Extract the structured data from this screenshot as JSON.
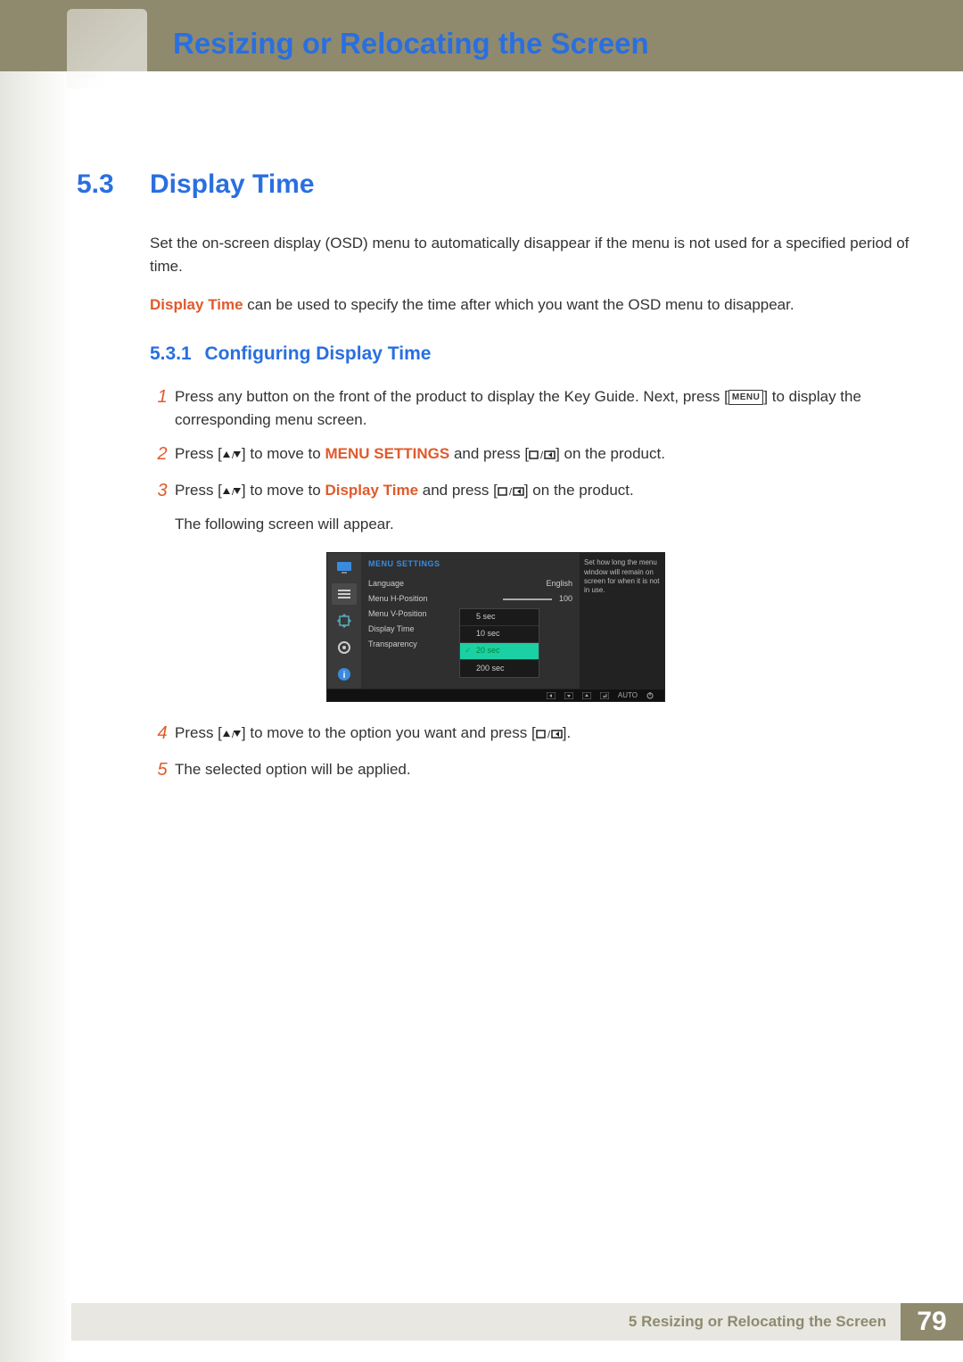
{
  "header": {
    "title": "Resizing or Relocating the Screen"
  },
  "section": {
    "number": "5.3",
    "title": "Display Time"
  },
  "intro": {
    "p1": "Set the on-screen display (OSD) menu to automatically disappear if the menu is not used for a specified period of time.",
    "p2a": "Display Time",
    "p2b": " can be used to specify the time after which you want the OSD menu to disappear."
  },
  "subsection": {
    "number": "5.3.1",
    "title": "Configuring Display Time"
  },
  "steps": {
    "s1_num": "1",
    "s1a": "Press any button on the front of the product to display the Key Guide. Next, press [",
    "s1_menu": "MENU",
    "s1b": "] to display the corresponding menu screen.",
    "s2_num": "2",
    "s2a": "Press [",
    "s2b": "] to move to ",
    "s2_hl": "MENU SETTINGS",
    "s2c": " and press [",
    "s2d": "] on the product.",
    "s3_num": "3",
    "s3a": "Press [",
    "s3b": "] to move to ",
    "s3_hl": "Display Time",
    "s3c": " and press [",
    "s3d": "] on the product.",
    "s3e": "The following screen will appear.",
    "s4_num": "4",
    "s4a": "Press [",
    "s4b": "] to move to the option you want and press [",
    "s4c": "].",
    "s5_num": "5",
    "s5": "The selected option will be applied."
  },
  "osd": {
    "title": "MENU SETTINGS",
    "rows": {
      "language_label": "Language",
      "language_value": "English",
      "hpos_label": "Menu H-Position",
      "hpos_value": "100",
      "vpos_label": "Menu V-Position",
      "displaytime_label": "Display Time",
      "transparency_label": "Transparency"
    },
    "help": "Set how long the menu window will remain on screen for when it is not in use.",
    "options": {
      "o1": "5 sec",
      "o2": "10 sec",
      "o3": "20 sec",
      "o4": "200 sec"
    },
    "bottombar": {
      "auto": "AUTO"
    }
  },
  "footer": {
    "chapter_num": "5",
    "chapter_title": "Resizing or Relocating the Screen",
    "page": "79"
  }
}
